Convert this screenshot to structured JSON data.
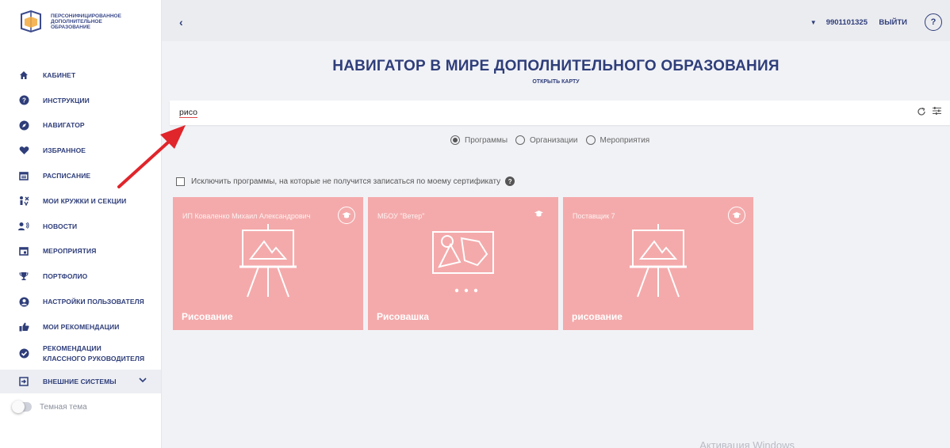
{
  "brand": {
    "logo_text": "ПЕРСОНИФИЦИРОВАННОЕ ДОПОЛНИТЕЛЬНОЕ ОБРАЗОВАНИЕ"
  },
  "sidebar": {
    "items": [
      {
        "label": "КАБИНЕТ",
        "icon": "home-icon"
      },
      {
        "label": "ИНСТРУКЦИИ",
        "icon": "help-circle-icon"
      },
      {
        "label": "НАВИГАТОР",
        "icon": "compass-icon"
      },
      {
        "label": "ИЗБРАННОЕ",
        "icon": "heart-icon"
      },
      {
        "label": "РАСПИСАНИЕ",
        "icon": "calendar-icon"
      },
      {
        "label": "МОИ КРУЖКИ И СЕКЦИИ",
        "icon": "activities-icon"
      },
      {
        "label": "НОВОСТИ",
        "icon": "announcement-icon"
      },
      {
        "label": "МЕРОПРИЯТИЯ",
        "icon": "event-icon"
      },
      {
        "label": "ПОРТФОЛИО",
        "icon": "trophy-icon"
      },
      {
        "label": "НАСТРОЙКИ ПОЛЬЗОВАТЕЛЯ",
        "icon": "user-settings-icon"
      },
      {
        "label": "МОИ РЕКОМЕНДАЦИИ",
        "icon": "thumbs-up-icon"
      },
      {
        "label": "РЕКОМЕНДАЦИИ КЛАССНОГО РУКОВОДИТЕЛЯ",
        "icon": "check-circle-icon"
      },
      {
        "label": "ВНЕШНИЕ СИСТЕМЫ",
        "icon": "external-login-icon"
      }
    ],
    "theme_label": "Темная тема"
  },
  "header": {
    "back": "‹",
    "user_id": "9901101325",
    "logout": "ВЫЙТИ",
    "help": "?"
  },
  "main": {
    "title": "НАВИГАТОР В МИРЕ ДОПОЛНИТЕЛЬНОГО ОБРАЗОВАНИЯ",
    "map_link": "ОТКРЫТЬ КАРТУ",
    "search_value": "рисо",
    "search_type": {
      "options": [
        "Программы",
        "Организации",
        "Мероприятия"
      ],
      "selected": "Программы"
    },
    "exclude_label": "Исключить программы, на которые не получится записаться по моему сертификату",
    "cards": [
      {
        "org": "ИП Коваленко Михаил Александрович",
        "title": "Рисование"
      },
      {
        "org": "МБОУ \"Ветер\"",
        "title": "Рисовашка"
      },
      {
        "org": "Поставщик 7",
        "title": "рисование"
      }
    ]
  },
  "watermark": "Активация Windows",
  "colors": {
    "primary": "#2f3e7a",
    "card": "#f4aaab",
    "annotation_arrow": "#e0252b"
  }
}
